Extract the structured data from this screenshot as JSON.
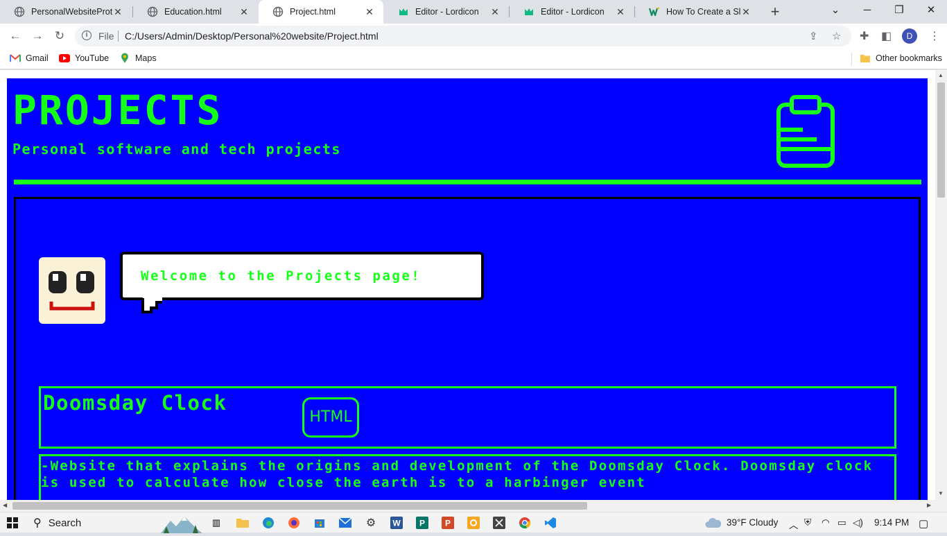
{
  "browser": {
    "tabs": [
      {
        "title": "PersonalWebsitePrototype",
        "icon": "globe-icon",
        "active": false
      },
      {
        "title": "Education.html",
        "icon": "globe-icon",
        "active": false
      },
      {
        "title": "Project.html",
        "icon": "globe-icon",
        "active": true
      },
      {
        "title": "Editor - Lordicon",
        "icon": "lordicon-crown-icon",
        "active": false
      },
      {
        "title": "Editor - Lordicon",
        "icon": "lordicon-crown-icon",
        "active": false
      },
      {
        "title": "How To Create a Slide",
        "icon": "w-logo-icon",
        "active": false
      }
    ],
    "new_tab": "+",
    "address": {
      "scheme_label": "File",
      "url": "C:/Users/Admin/Desktop/Personal%20website/Project.html"
    },
    "profile_initial": "D",
    "bookmarks": [
      {
        "label": "Gmail",
        "icon": "gmail-icon"
      },
      {
        "label": "YouTube",
        "icon": "youtube-icon"
      },
      {
        "label": "Maps",
        "icon": "maps-icon"
      }
    ],
    "other_bookmarks": "Other bookmarks"
  },
  "page": {
    "title": "PROJECTS",
    "subtitle": "Personal software and tech projects",
    "icon": "clipboard-icon",
    "welcome": "Welcome to the Projects page!",
    "project": {
      "name": "Doomsday Clock",
      "badge": "HTML",
      "description": " -Website that explains the origins and development of the Doomsday Clock. Doomsday clock is used to calculate how close the earth is to a harbinger event"
    }
  },
  "colors": {
    "page_bg": "#0000fe",
    "accent": "#16ff16"
  },
  "taskbar": {
    "search_label": "Search",
    "weather": "39°F  Cloudy",
    "time": "9:14 PM"
  }
}
